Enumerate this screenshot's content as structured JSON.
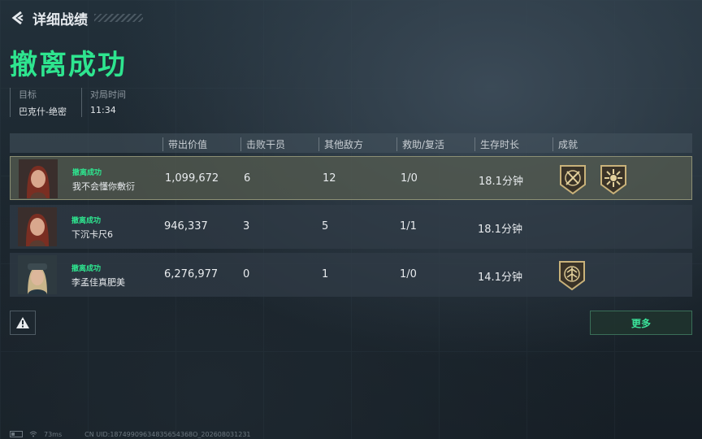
{
  "header": {
    "title": "详细战绩"
  },
  "result": {
    "title": "撤离成功"
  },
  "info": [
    {
      "key": "目标",
      "value": "巴克什-绝密"
    },
    {
      "key": "对局时间",
      "value": "11:34"
    }
  ],
  "columns": [
    "带出价值",
    "击败干员",
    "其他敌方",
    "救助/复活",
    "生存时长",
    "成就"
  ],
  "rows": [
    {
      "status": "撤离成功",
      "name": "我不会懂你敷衍",
      "value": "1,099,672",
      "kills": "6",
      "other": "12",
      "assist": "1/0",
      "survive": "18.1分钟",
      "badges": [
        "crossed-weapons-badge-icon",
        "sunburst-badge-icon"
      ],
      "highlight": true
    },
    {
      "status": "撤离成功",
      "name": "下沉卡尺6",
      "value": "946,337",
      "kills": "3",
      "other": "5",
      "assist": "1/1",
      "survive": "18.1分钟",
      "badges": [],
      "highlight": false
    },
    {
      "status": "撤离成功",
      "name": "李孟佳真肥美",
      "value": "6,276,977",
      "kills": "0",
      "other": "1",
      "assist": "1/0",
      "survive": "14.1分钟",
      "badges": [
        "emblem-badge-icon"
      ],
      "highlight": false
    }
  ],
  "buttons": {
    "more": "更多"
  },
  "footer": {
    "ping": "73ms",
    "uid": "CN UID:18749909634835654368O_202608031231"
  },
  "colors": {
    "accent": "#2ee58f",
    "highlight_border": "#8c8f74"
  }
}
